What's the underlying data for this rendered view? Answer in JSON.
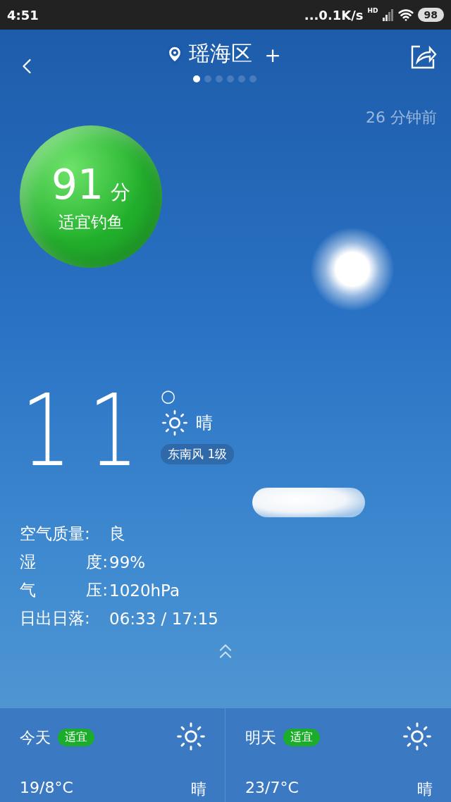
{
  "status_bar": {
    "time": "4:51",
    "network_speed": "...0.1K/s",
    "signal_tag": "HD",
    "battery": "98"
  },
  "header": {
    "city": "瑶海区",
    "add": "＋",
    "pages": [
      {
        "selected": true
      },
      {
        "selected": false
      },
      {
        "selected": false
      },
      {
        "selected": false
      },
      {
        "selected": false
      },
      {
        "selected": false
      }
    ]
  },
  "updated": "26 分钟前",
  "fishing_score": {
    "score": "91",
    "unit": "分",
    "label": "适宜钓鱼",
    "color": "#22b02c"
  },
  "current": {
    "temperature": "11",
    "degree": "○",
    "condition": "晴",
    "wind": "东南风 1级"
  },
  "details": [
    {
      "label": [
        "空气质量:"
      ],
      "value": "良"
    },
    {
      "label": [
        "湿",
        "度:"
      ],
      "value": "99%"
    },
    {
      "label": [
        "气",
        "压:"
      ],
      "value": "1020hPa"
    },
    {
      "label": [
        "日出日落:"
      ],
      "value": "06:33 / 17:15"
    }
  ],
  "forecast": [
    {
      "day": "今天",
      "badge": "适宜",
      "range": "19/8°C",
      "condition": "晴"
    },
    {
      "day": "明天",
      "badge": "适宜",
      "range": "23/7°C",
      "condition": "晴"
    }
  ]
}
